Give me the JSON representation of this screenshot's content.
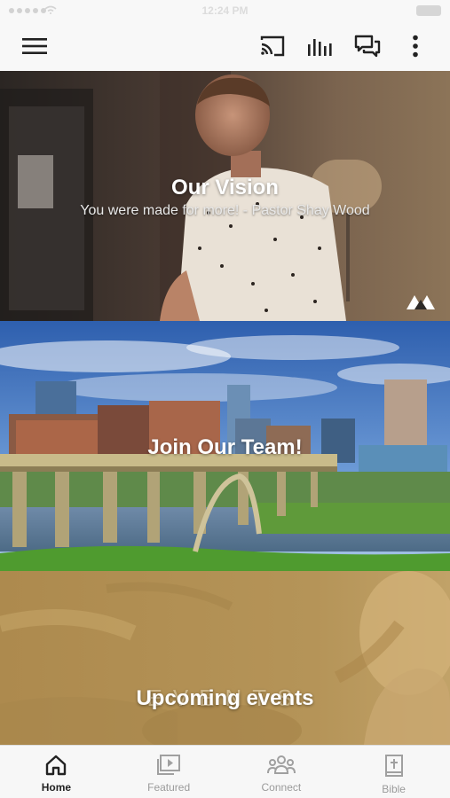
{
  "status_bar": {
    "time": "12:24 PM"
  },
  "app_bar": {
    "menu_icon": "hamburger-menu-icon",
    "actions": [
      "cast-icon",
      "audio-bars-icon",
      "chat-icon",
      "more-vert-icon"
    ]
  },
  "banners": [
    {
      "title": "Our Vision",
      "subtitle": "You were made for more! - Pastor Shay Wood"
    },
    {
      "title": "Join Our Team!"
    },
    {
      "title": "Upcoming events",
      "watermark": "EVENTS"
    }
  ],
  "tabs": [
    {
      "label": "Home",
      "icon": "home-icon",
      "active": true
    },
    {
      "label": "Featured",
      "icon": "featured-video-icon",
      "active": false
    },
    {
      "label": "Connect",
      "icon": "people-icon",
      "active": false
    },
    {
      "label": "Bible",
      "icon": "bible-icon",
      "active": false
    }
  ],
  "colors": {
    "tab_active": "#222222",
    "tab_inactive": "#9b9b9b",
    "events_tint": "#b08c4c"
  }
}
